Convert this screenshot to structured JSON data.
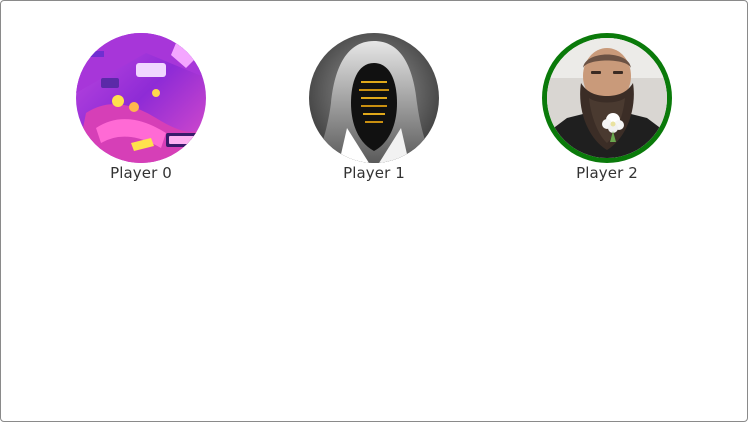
{
  "players": [
    {
      "name": "Player 0",
      "avatar_icon": "pinball-artwork-avatar-icon",
      "active": false
    },
    {
      "name": "Player 1",
      "avatar_icon": "hooded-hacker-avatar-icon",
      "active": false
    },
    {
      "name": "Player 2",
      "avatar_icon": "bearded-man-avatar-icon",
      "active": true
    }
  ],
  "active_color": "#0a7a0a"
}
